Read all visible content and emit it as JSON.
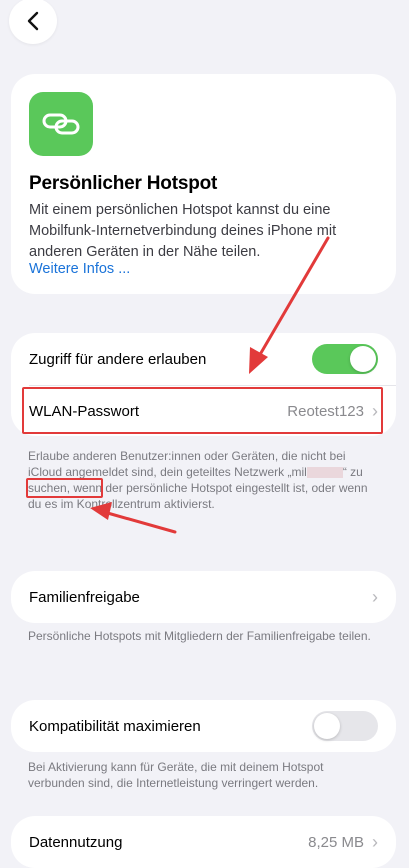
{
  "nav": {
    "back_icon": "chevron-left-icon"
  },
  "hero": {
    "icon": "link-icon",
    "title": "Persönlicher Hotspot",
    "description": "Mit einem persönlichen Hotspot kannst du eine Mobilfunk-Internetverbindung deines iPhone mit anderen Geräten in der Nähe teilen.",
    "link": "Weitere Infos ..."
  },
  "access": {
    "allow_label": "Zugriff für andere erlauben",
    "allow_on": true,
    "wifi_label": "WLAN-Passwort",
    "wifi_value": "Reotest123",
    "note_before": "Erlaube anderen Benutzer:innen oder Geräten, die nicht bei iCloud angemeldet sind, dein geteiltes Netzwerk „mil",
    "note_after": "“ zu suchen, wenn der persönliche Hotspot eingestellt ist, oder wenn du es im Kontrollzentrum aktivierst."
  },
  "family": {
    "label": "Familienfreigabe",
    "note": "Persönliche Hotspots mit Mitgliedern der Familienfreigabe teilen."
  },
  "compat": {
    "label": "Kompatibilität maximieren",
    "on": false,
    "note": "Bei Aktivierung kann für Geräte, die mit deinem Hotspot verbunden sind, die Internetleistung verringert werden."
  },
  "data_usage": {
    "label": "Datennutzung",
    "value": "8,25 MB"
  },
  "colors": {
    "toggle_on": "#5ac85a",
    "toggle_off": "#e6e6ea",
    "annotation": "#e23a3a",
    "link": "#1a73d9"
  }
}
